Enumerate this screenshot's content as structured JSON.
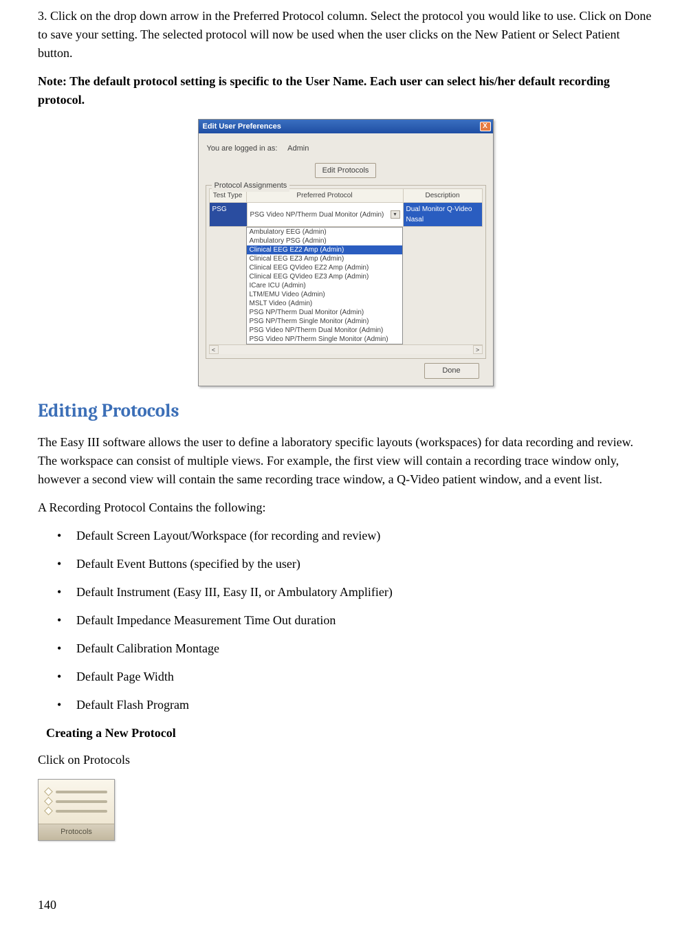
{
  "step3_num": "3.",
  "step3_text": "Click on the drop down arrow in the Preferred Protocol column.  Select the protocol you would like to use. Click on Done to save your setting.  The selected protocol will now be used when the user clicks on the New Patient or Select Patient button.",
  "note_text": "Note:  The default protocol setting is specific to the User Name.  Each user can select his/her default recording protocol.",
  "dlg": {
    "title": "Edit User Preferences",
    "close": "X",
    "logged_label": "You are logged in as:",
    "logged_user": "Admin",
    "edit_protocols_btn": "Edit Protocols",
    "fieldset_label": "Protocol Assignments",
    "hdr_a": "Test Type",
    "hdr_b": "Preferred Protocol",
    "hdr_c": "Description",
    "row_test": "PSG",
    "row_proto": "PSG Video NP/Therm Dual Monitor (Admin)",
    "row_desc": "Dual Monitor Q-Video Nasal",
    "dd_items": [
      "Ambulatory EEG (Admin)",
      "Ambulatory PSG (Admin)",
      "Clinical EEG EZ2 Amp (Admin)",
      "Clinical EEG EZ3 Amp (Admin)",
      "Clinical EEG QVideo EZ2 Amp (Admin)",
      "Clinical EEG QVideo EZ3 Amp (Admin)",
      "ICare ICU (Admin)",
      "LTM/EMU Video (Admin)",
      "MSLT Video (Admin)",
      "PSG NP/Therm Dual Monitor (Admin)",
      "PSG NP/Therm Single Monitor (Admin)",
      "PSG Video NP/Therm Dual Monitor (Admin)",
      "PSG Video NP/Therm Single Monitor (Admin)"
    ],
    "dd_selected_index": 2,
    "scroll_left": "<",
    "scroll_right": ">",
    "done_btn": "Done"
  },
  "h2_editing": "Editing Protocols",
  "para1": "The Easy III software allows the user to define a laboratory specific layouts (workspaces) for data recording and review.  The workspace can consist of multiple views.  For example, the first view will contain a recording trace window only, however a second view will contain the same recording trace window, a Q-Video patient window, and a event list.",
  "para2": "A Recording Protocol Contains the following:",
  "bullets": [
    "Default Screen Layout/Workspace (for recording and review)",
    "Default Event Buttons (specified by the user)",
    "Default Instrument (Easy III, Easy II, or Ambulatory Amplifier)",
    "Default Impedance Measurement Time Out duration",
    "Default Calibration Montage",
    "Default Page Width",
    "Default Flash Program"
  ],
  "sub_hd": "Creating a New Protocol",
  "para3": "Click on Protocols",
  "proto_btn_label": "Protocols",
  "page_num": "140"
}
